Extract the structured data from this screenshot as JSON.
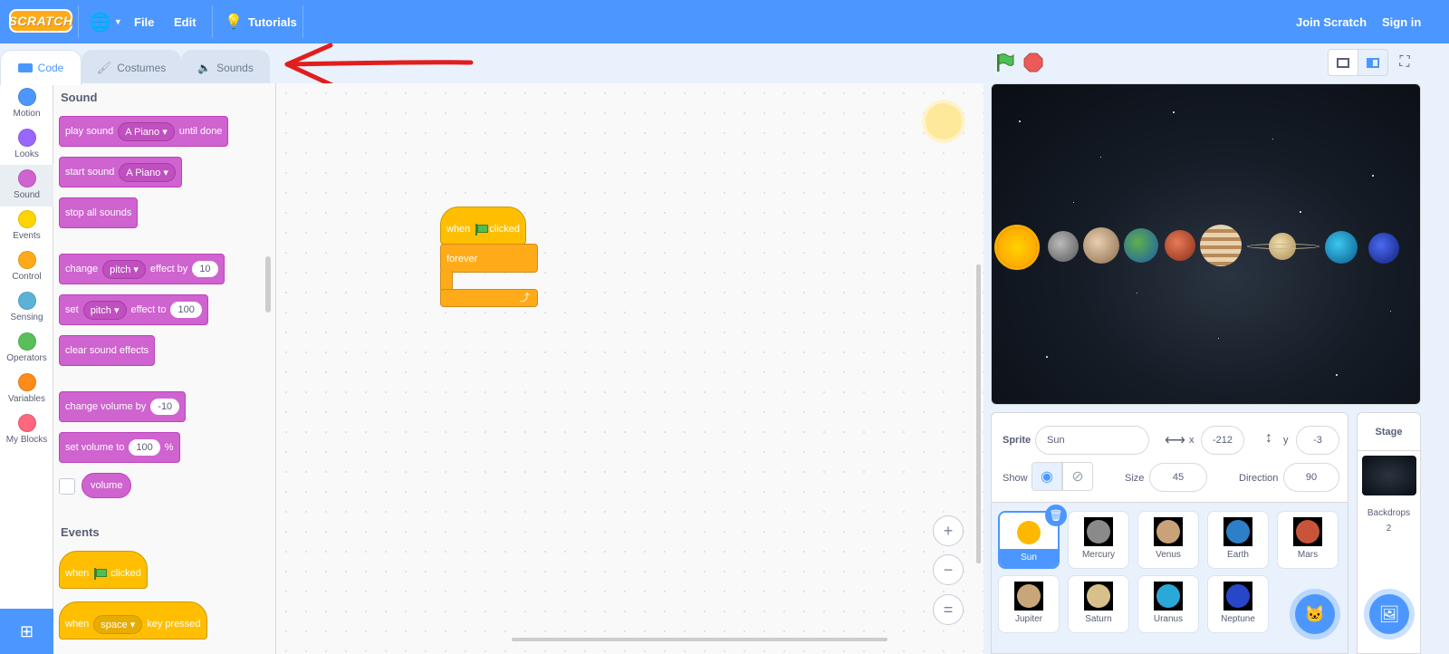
{
  "menu": {
    "logo": "SCRATCH",
    "file": "File",
    "edit": "Edit",
    "tutorials": "Tutorials",
    "join": "Join Scratch",
    "signin": "Sign in"
  },
  "tabs": {
    "code": "Code",
    "costumes": "Costumes",
    "sounds": "Sounds"
  },
  "categories": [
    "Motion",
    "Looks",
    "Sound",
    "Events",
    "Control",
    "Sensing",
    "Operators",
    "Variables",
    "My Blocks"
  ],
  "category_colors": [
    "#4c97ff",
    "#9966ff",
    "#cf63cf",
    "#ffd500",
    "#ffab19",
    "#5cb1d6",
    "#59c059",
    "#ff8c1a",
    "#ff6680"
  ],
  "palette": {
    "sound_heading": "Sound",
    "events_heading": "Events",
    "play_sound": {
      "a": "play sound",
      "dd": "A Piano",
      "b": "until done"
    },
    "start_sound": {
      "a": "start sound",
      "dd": "A Piano"
    },
    "stop_all": "stop all sounds",
    "change_effect": {
      "a": "change",
      "dd": "pitch",
      "b": "effect by",
      "v": "10"
    },
    "set_effect": {
      "a": "set",
      "dd": "pitch",
      "b": "effect to",
      "v": "100"
    },
    "clear_effects": "clear sound effects",
    "change_volume": {
      "a": "change volume by",
      "v": "-10"
    },
    "set_volume": {
      "a": "set volume to",
      "v": "100",
      "b": "%"
    },
    "volume": "volume",
    "when_flag": {
      "a": "when",
      "b": "clicked"
    },
    "when_key": {
      "a": "when",
      "dd": "space",
      "b": "key pressed"
    }
  },
  "script": {
    "hat_a": "when",
    "hat_b": "clicked",
    "forever": "forever"
  },
  "zoom": {
    "in": "+",
    "out": "−",
    "reset": "="
  },
  "sprite_info": {
    "sprite_label": "Sprite",
    "sprite_name": "Sun",
    "x_label": "x",
    "x_value": "-212",
    "y_label": "y",
    "y_value": "-3",
    "show_label": "Show",
    "size_label": "Size",
    "size_value": "45",
    "direction_label": "Direction",
    "direction_value": "90"
  },
  "sprites": [
    {
      "name": "Sun",
      "color": "#ffb800"
    },
    {
      "name": "Mercury",
      "color": "#8a8a8a"
    },
    {
      "name": "Venus",
      "color": "#c9a27a"
    },
    {
      "name": "Earth",
      "color": "#2d7fc8"
    },
    {
      "name": "Mars",
      "color": "#c8553a"
    },
    {
      "name": "Jupiter",
      "color": "#c9a67a"
    },
    {
      "name": "Saturn",
      "color": "#d8c08a"
    },
    {
      "name": "Uranus",
      "color": "#2aa8d8"
    },
    {
      "name": "Neptune",
      "color": "#2746c8"
    }
  ],
  "stage_panel": {
    "title": "Stage",
    "backdrops_label": "Backdrops",
    "backdrops_count": "2"
  }
}
